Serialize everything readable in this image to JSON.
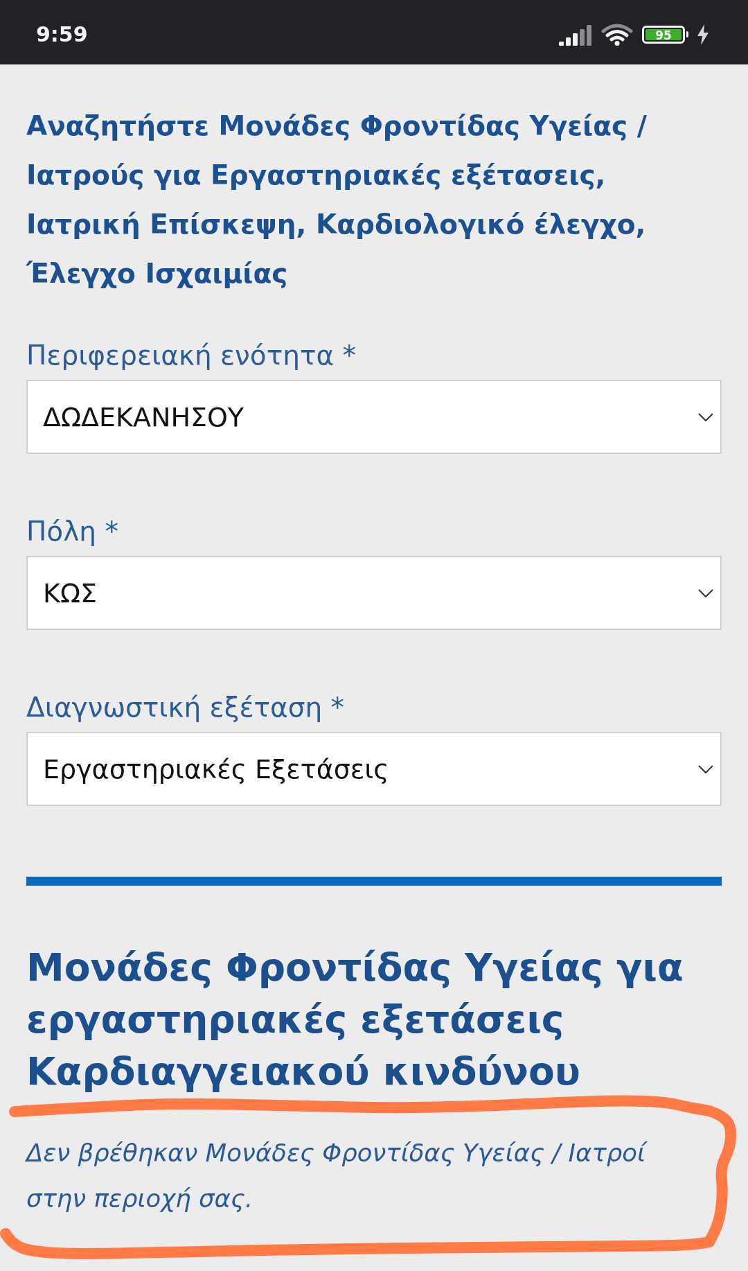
{
  "status_bar": {
    "time": "9:59",
    "battery": "95"
  },
  "title": "Αναζητήστε Μονάδες Φροντίδας Υγείας / Ιατρούς για Εργαστηριακές εξέτασεις, Ιατρική Επίσκεψη, Καρδιολογικό έλεγχο, Έλεγχο Ισχαιμίας",
  "fields": [
    {
      "label": "Περιφερειακή ενότητα *",
      "value": "ΔΩΔΕΚΑΝΗΣΟΥ"
    },
    {
      "label": "Πόλη *",
      "value": "ΚΩΣ"
    },
    {
      "label": "Διαγνωστική εξέταση *",
      "value": "Εργαστηριακές Εξετάσεις"
    }
  ],
  "results": {
    "heading": "Μονάδες Φροντίδας Υγείας για εργαστηριακές εξετάσεις Καρδιαγγειακού κινδύνου",
    "message": "Δεν βρέθηκαν Μονάδες Φροντίδας Υγείας / Ιατροί στην περιοχή σας."
  }
}
